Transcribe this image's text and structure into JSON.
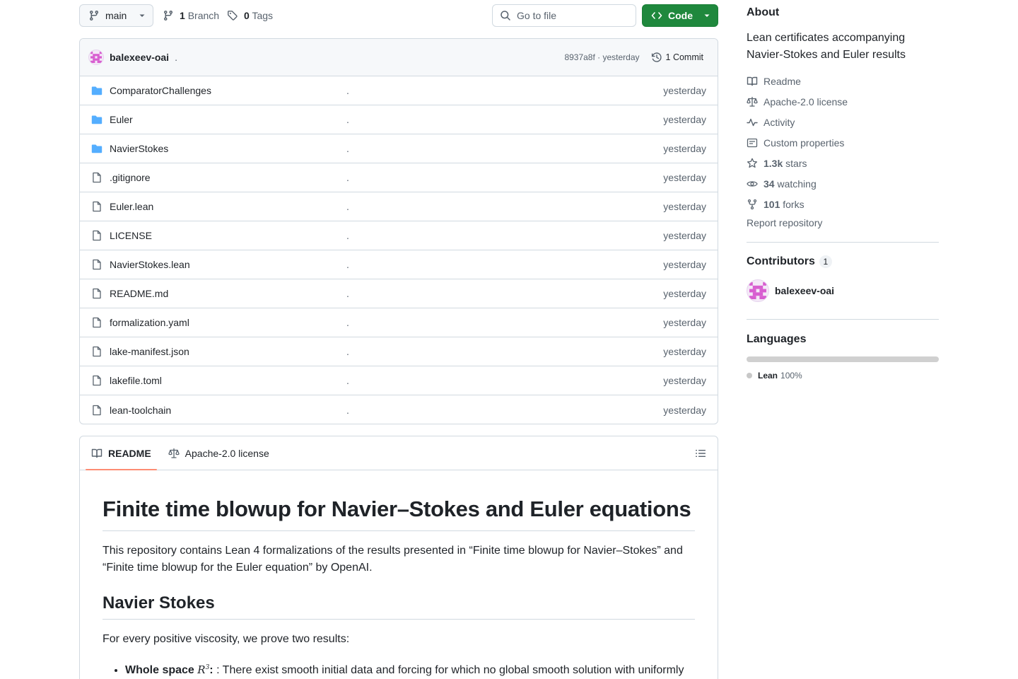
{
  "toolbar": {
    "branch_name": "main",
    "branch_count": "1",
    "branch_label": "Branch",
    "tag_count": "0",
    "tag_label": "Tags",
    "goto_file_placeholder": "Go to file",
    "code_label": "Code"
  },
  "commit": {
    "author": "balexeev-oai",
    "message": ".",
    "hash_time": "8937a8f · yesterday",
    "commit_count": "1 Commit"
  },
  "files": [
    {
      "name": "ComparatorChallenges",
      "type": "folder",
      "message": ".",
      "date": "yesterday"
    },
    {
      "name": "Euler",
      "type": "folder",
      "message": ".",
      "date": "yesterday"
    },
    {
      "name": "NavierStokes",
      "type": "folder",
      "message": ".",
      "date": "yesterday"
    },
    {
      "name": ".gitignore",
      "type": "file",
      "message": ".",
      "date": "yesterday"
    },
    {
      "name": "Euler.lean",
      "type": "file",
      "message": ".",
      "date": "yesterday"
    },
    {
      "name": "LICENSE",
      "type": "file",
      "message": ".",
      "date": "yesterday"
    },
    {
      "name": "NavierStokes.lean",
      "type": "file",
      "message": ".",
      "date": "yesterday"
    },
    {
      "name": "README.md",
      "type": "file",
      "message": ".",
      "date": "yesterday"
    },
    {
      "name": "formalization.yaml",
      "type": "file",
      "message": ".",
      "date": "yesterday"
    },
    {
      "name": "lake-manifest.json",
      "type": "file",
      "message": ".",
      "date": "yesterday"
    },
    {
      "name": "lakefile.toml",
      "type": "file",
      "message": ".",
      "date": "yesterday"
    },
    {
      "name": "lean-toolchain",
      "type": "file",
      "message": ".",
      "date": "yesterday"
    }
  ],
  "readme": {
    "tab_readme": "README",
    "tab_license": "Apache-2.0 license",
    "h1": "Finite time blowup for Navier–Stokes and Euler equations",
    "p1": "This repository contains Lean 4 formalizations of the results presented in “Finite time blowup for Navier–Stokes” and “Finite time blowup for the Euler equation” by OpenAI.",
    "h2": "Navier Stokes",
    "p2": "For every positive viscosity, we prove two results:",
    "bullet1_bold": "Whole space",
    "bullet1_math": "R",
    "bullet1_sup": "3",
    "bullet1_text": ": There exist smooth initial data and forcing for which no global smooth solution with uniformly"
  },
  "about": {
    "heading": "About",
    "description": "Lean certificates accompanying Navier-Stokes and Euler results",
    "readme": "Readme",
    "license": "Apache-2.0 license",
    "activity": "Activity",
    "custom_properties": "Custom properties",
    "stars_count": "1.3k",
    "stars_label": "stars",
    "watching_count": "34",
    "watching_label": "watching",
    "forks_count": "101",
    "forks_label": "forks",
    "report": "Report repository"
  },
  "contributors": {
    "heading": "Contributors",
    "count": "1",
    "items": [
      {
        "name": "balexeev-oai"
      }
    ]
  },
  "languages": {
    "heading": "Languages",
    "items": [
      {
        "name": "Lean",
        "percent": "100%",
        "fraction": 1.0,
        "color": "#c8c8c8"
      }
    ]
  },
  "colors": {
    "code_button": "#1f883d",
    "tab_underline": "#fd8c73",
    "folder_icon": "#54aeff",
    "avatar_pink": "#d85ed0"
  }
}
